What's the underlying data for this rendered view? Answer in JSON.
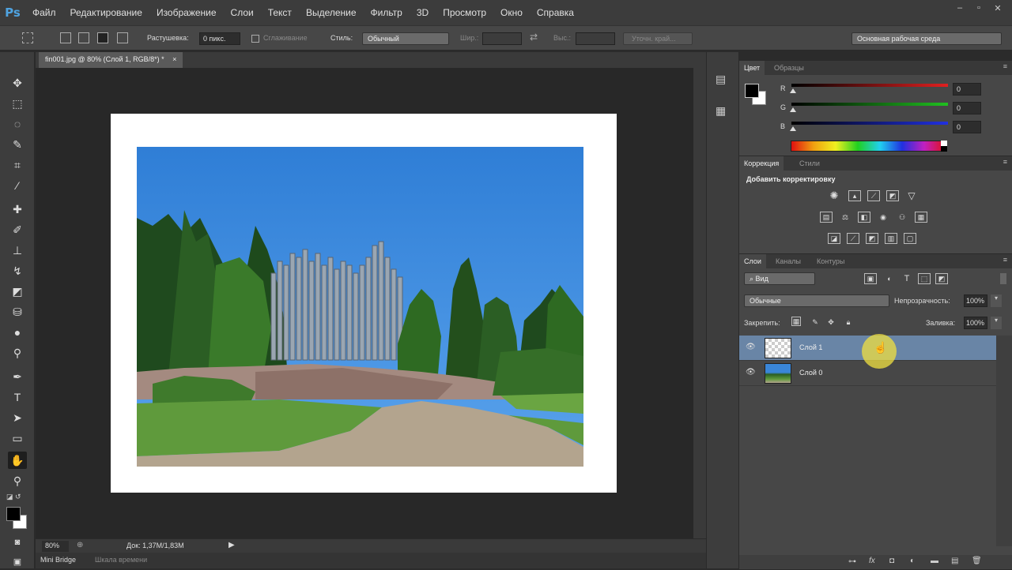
{
  "app": {
    "logo": "Ps"
  },
  "menu": [
    "Файл",
    "Редактирование",
    "Изображение",
    "Слои",
    "Текст",
    "Выделение",
    "Фильтр",
    "3D",
    "Просмотр",
    "Окно",
    "Справка"
  ],
  "window_controls": {
    "minimize": "‒",
    "restore": "▫",
    "close": "✕"
  },
  "options_bar": {
    "feather_label": "Растушевка:",
    "feather_value": "0 пикс.",
    "antialias_label": "Сглаживание",
    "style_label": "Стиль:",
    "style_value": "Обычный",
    "width_label": "Шир.:",
    "height_label": "Выс.:",
    "refine_edge": "Уточн. край...",
    "workspace": "Основная рабочая среда"
  },
  "document": {
    "tab_title": "fin001.jpg @ 80% (Слой 1, RGB/8*) *",
    "tab_close": "×",
    "zoom": "80%",
    "doc_info": "Док: 1,37M/1,83M"
  },
  "bottom_tabs": [
    "Mini Bridge",
    "Шкала времени"
  ],
  "color_panel": {
    "tabs": [
      "Цвет",
      "Образцы"
    ],
    "menu_icon": "≡",
    "channels": [
      {
        "label": "R",
        "value": "0",
        "color": "#e02020"
      },
      {
        "label": "G",
        "value": "0",
        "color": "#20c020"
      },
      {
        "label": "B",
        "value": "0",
        "color": "#2030e0"
      }
    ]
  },
  "adjustments_panel": {
    "tabs": [
      "Коррекция",
      "Стили"
    ],
    "title": "Добавить корректировку"
  },
  "layers_panel": {
    "tabs": [
      "Слои",
      "Каналы",
      "Контуры"
    ],
    "filter_kind": "Вид",
    "blend_mode": "Обычные",
    "opacity_label": "Непрозрачность:",
    "opacity_value": "100%",
    "lock_label": "Закрепить:",
    "fill_label": "Заливка:",
    "fill_value": "100%",
    "layers": [
      {
        "name": "Слой 1",
        "selected": true
      },
      {
        "name": "Слой 0",
        "selected": false
      }
    ]
  },
  "colors": {
    "selection": "#6985a6",
    "sky": "#3a86d8",
    "cursor_highlight": "#f0e040"
  }
}
